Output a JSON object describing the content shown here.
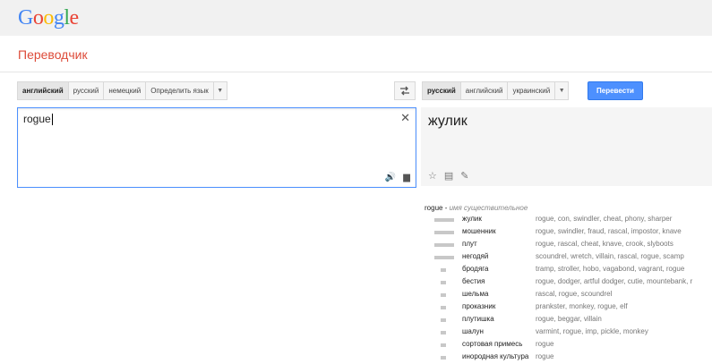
{
  "logo": "Google",
  "app_title": "Переводчик",
  "source_langs": [
    "английский",
    "русский",
    "немецкий",
    "Определить язык"
  ],
  "source_selected": 0,
  "target_langs": [
    "русский",
    "английский",
    "украинский"
  ],
  "target_selected": 0,
  "translate_label": "Перевести",
  "input_text": "rogue",
  "result_text": "жулик",
  "dictionary": {
    "word": "rogue",
    "separator": "-",
    "pos": "имя существительное",
    "entries": [
      {
        "term": "жулик",
        "synonyms": "rogue, con, swindler, cheat, phony, sharper",
        "freq": 3
      },
      {
        "term": "мошенник",
        "synonyms": "rogue, swindler, fraud, rascal, impostor, knave",
        "freq": 3
      },
      {
        "term": "плут",
        "synonyms": "rogue, rascal, cheat, knave, crook, slyboots",
        "freq": 3
      },
      {
        "term": "негодяй",
        "synonyms": "scoundrel, wretch, villain, rascal, rogue, scamp",
        "freq": 3
      },
      {
        "term": "бродяга",
        "synonyms": "tramp, stroller, hobo, vagabond, vagrant, rogue",
        "freq": 1
      },
      {
        "term": "бестия",
        "synonyms": "rogue, dodger, artful dodger, cutie, mountebank, r",
        "freq": 1
      },
      {
        "term": "шельма",
        "synonyms": "rascal, rogue, scoundrel",
        "freq": 1
      },
      {
        "term": "проказник",
        "synonyms": "prankster, monkey, rogue, elf",
        "freq": 1
      },
      {
        "term": "плутишка",
        "synonyms": "rogue, beggar, villain",
        "freq": 1
      },
      {
        "term": "шалун",
        "synonyms": "varmint, rogue, imp, pickle, monkey",
        "freq": 1
      },
      {
        "term": "сортовая примесь",
        "synonyms": "rogue",
        "freq": 1
      },
      {
        "term": "инородная культура",
        "synonyms": "rogue",
        "freq": 1
      }
    ]
  },
  "colors": {
    "accent": "#4d90fe",
    "title": "#dd4b39"
  },
  "icons": {
    "clear": "close-icon",
    "speaker": "speaker-icon",
    "keyboard": "keyboard-icon",
    "swap": "swap-icon",
    "star": "star-icon",
    "list": "list-icon",
    "edit": "pencil-icon",
    "dropdown": "chevron-down-icon"
  }
}
